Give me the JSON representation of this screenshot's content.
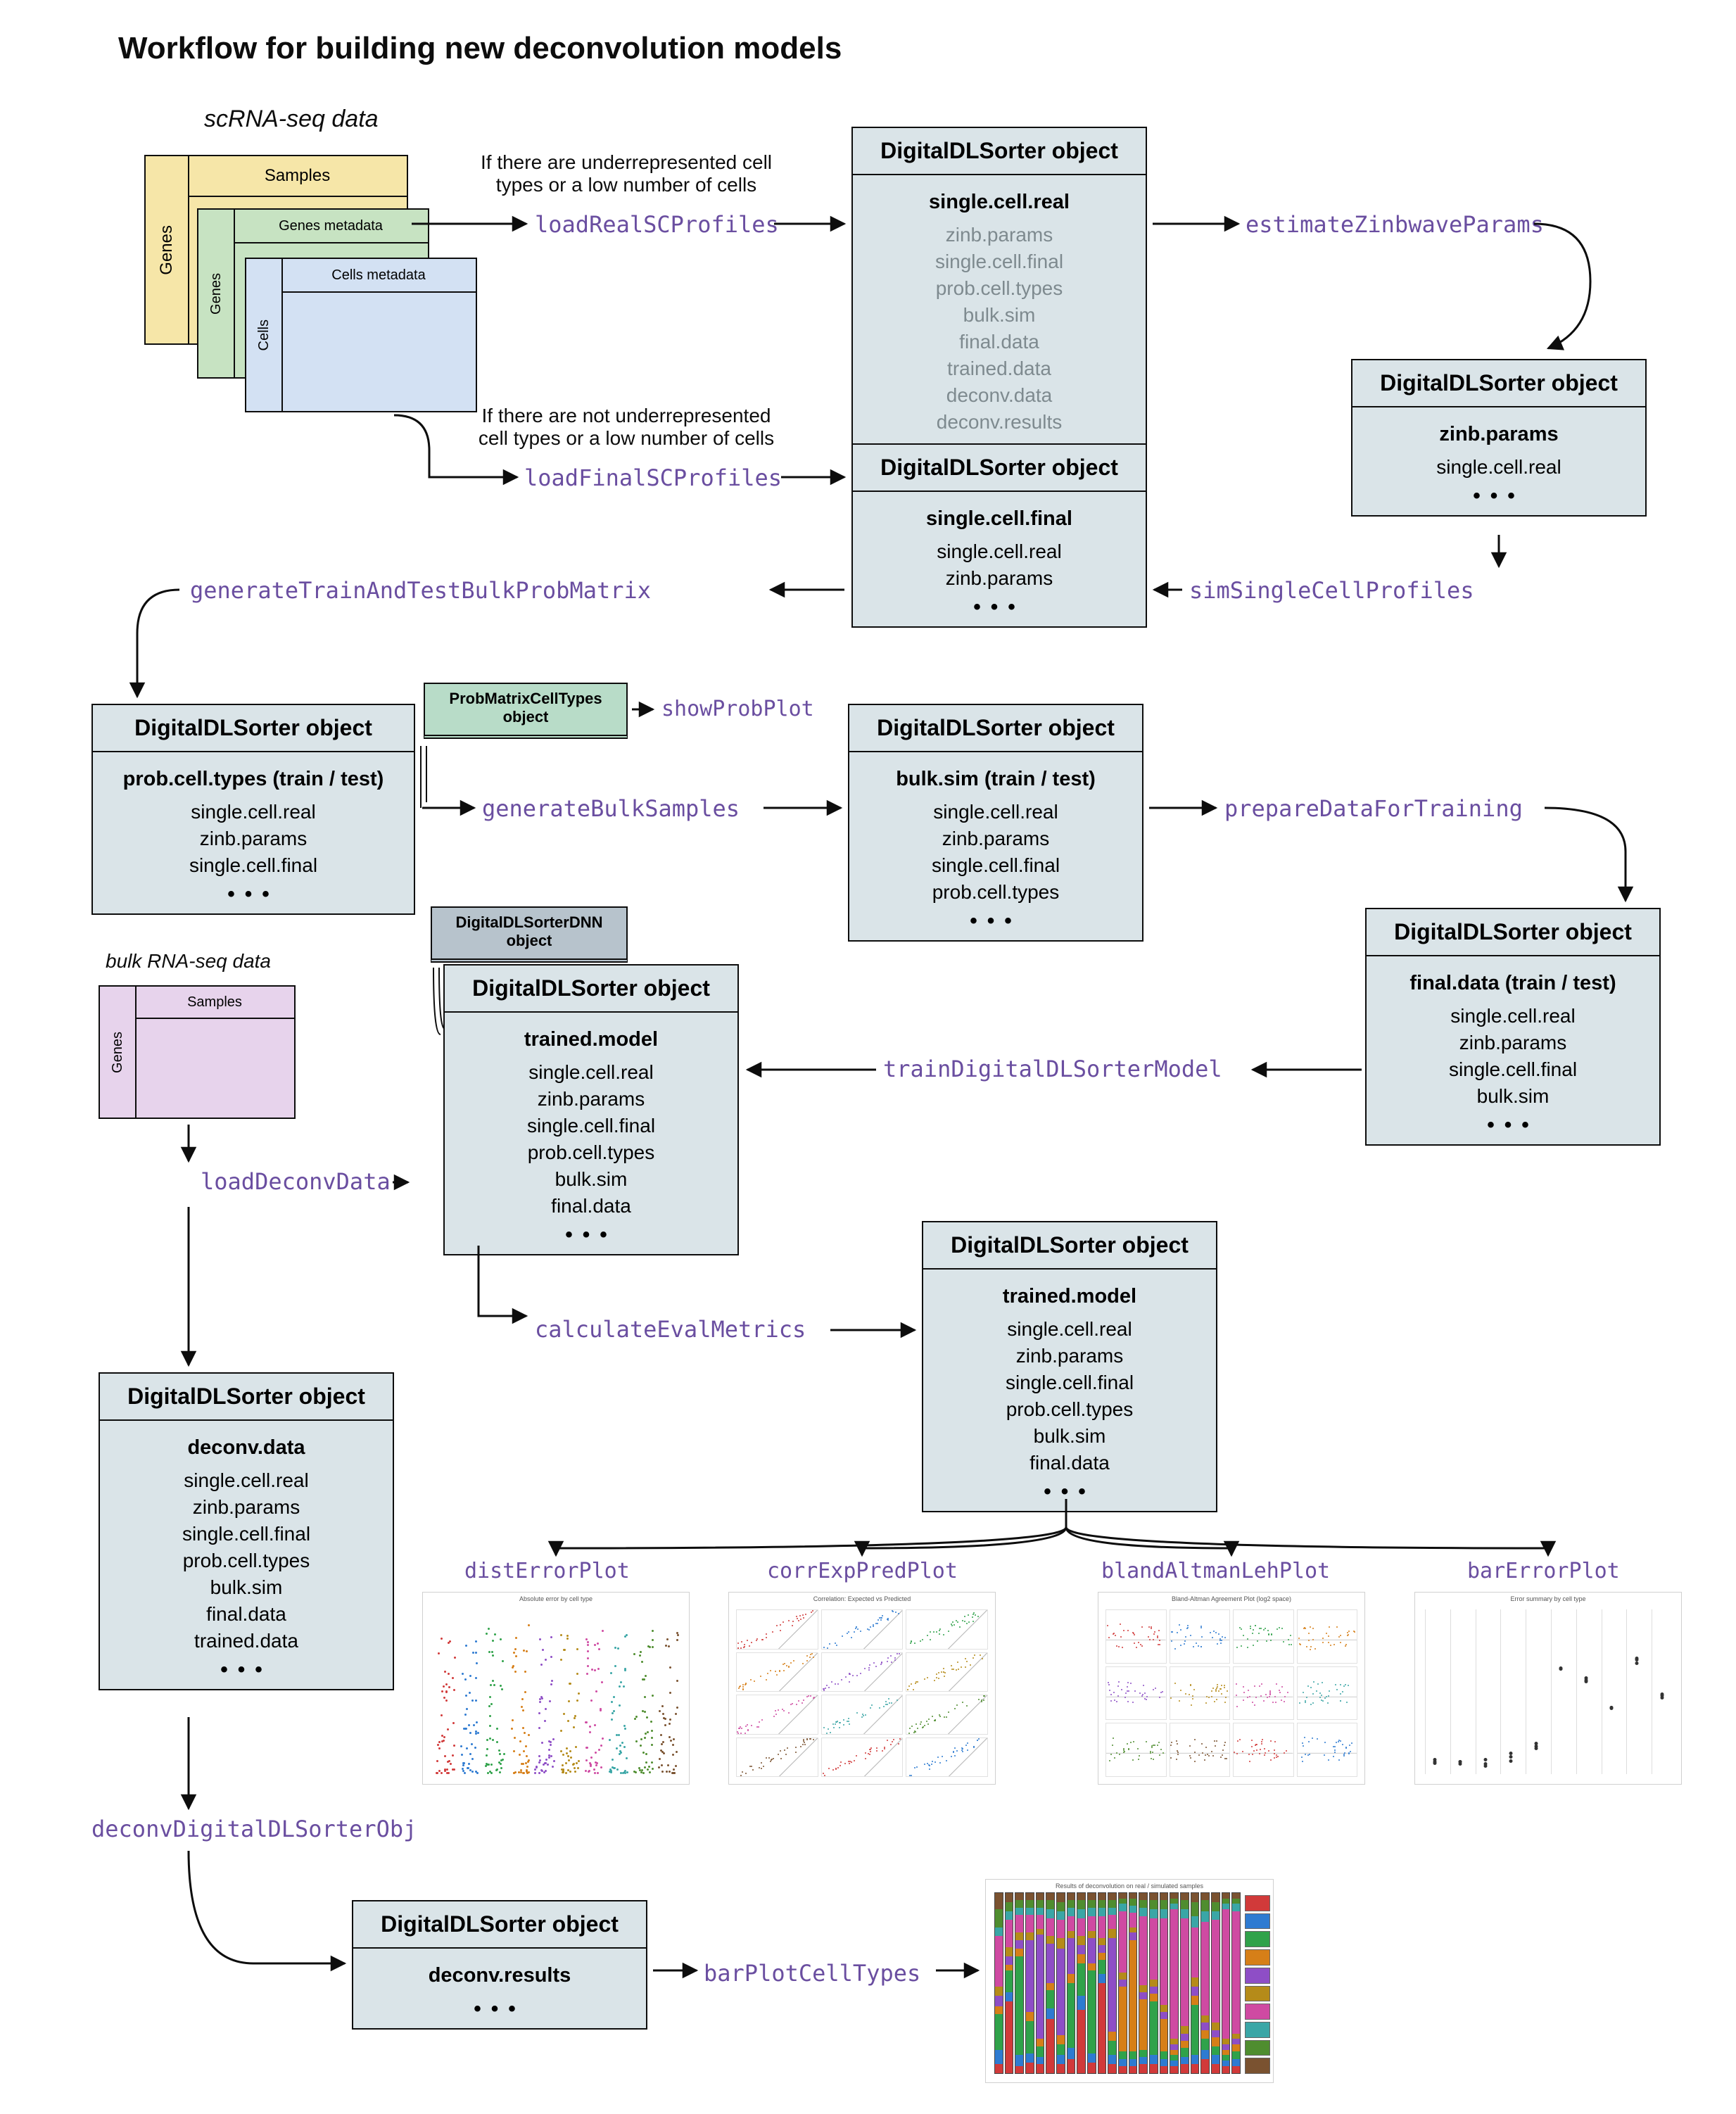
{
  "title": "Workflow for building new deconvolution models",
  "sc_label": "scRNA-seq data",
  "bulk_label": "bulk RNA-seq data",
  "cond1": "If there are underrepresented cell\ntypes or a low number of cells",
  "cond2": "If there are not underrepresented\ncell types or a low number of cells",
  "sc_panels": {
    "samples": {
      "side": "Genes",
      "top": "Samples"
    },
    "gmeta": {
      "side": "Genes",
      "top": "Genes metadata"
    },
    "cmeta": {
      "side": "Cells",
      "top": "Cells metadata"
    }
  },
  "bulk_panel": {
    "side": "Genes",
    "top": "Samples"
  },
  "fn": {
    "loadReal": "loadRealSCProfiles",
    "loadFinal": "loadFinalSCProfiles",
    "estZinb": "estimateZinbwaveParams",
    "simSC": "simSingleCellProfiles",
    "genMat": "generateTrainAndTestBulkProbMatrix",
    "showProb": "showProbPlot",
    "genBulk": "generateBulkSamples",
    "prep": "prepareDataForTraining",
    "train": "trainDigitalDLSorterModel",
    "eval": "calculateEvalMetrics",
    "loadDeconv": "loadDeconvData",
    "deconvObj": "deconvDigitalDLSorterObj",
    "barCT": "barPlotCellTypes",
    "distErr": "distErrorPlot",
    "corr": "corrExpPredPlot",
    "bland": "blandAltmanLehPlot",
    "barErr": "barErrorPlot"
  },
  "mini": {
    "prob": "ProbMatrixCellTypes\nobject",
    "dnn": "DigitalDLSorterDNN\nobject"
  },
  "obj_title": "DigitalDLSorter object",
  "boxes": {
    "scReal": {
      "bold": "single.cell.real",
      "gray": true,
      "slots": [
        "zinb.params",
        "single.cell.final",
        "prob.cell.types",
        "bulk.sim",
        "final.data",
        "trained.data",
        "deconv.data",
        "deconv.results"
      ],
      "dots": false
    },
    "zinb": {
      "bold": "zinb.params",
      "slots": [
        "single.cell.real"
      ],
      "dots": true
    },
    "scFinal": {
      "bold": "single.cell.final",
      "slots": [
        "single.cell.real",
        "zinb.params"
      ],
      "dots": true
    },
    "probCT": {
      "bold": "prob.cell.types (train / test)",
      "slots": [
        "single.cell.real",
        "zinb.params",
        "single.cell.final"
      ],
      "dots": true
    },
    "bulkSim": {
      "bold": "bulk.sim (train / test)",
      "slots": [
        "single.cell.real",
        "zinb.params",
        "single.cell.final",
        "prob.cell.types"
      ],
      "dots": true
    },
    "finalD": {
      "bold": "final.data (train / test)",
      "slots": [
        "single.cell.real",
        "zinb.params",
        "single.cell.final",
        "bulk.sim"
      ],
      "dots": true
    },
    "trained": {
      "bold": "trained.model",
      "slots": [
        "single.cell.real",
        "zinb.params",
        "single.cell.final",
        "prob.cell.types",
        "bulk.sim",
        "final.data"
      ],
      "dots": true
    },
    "evalTrained": {
      "bold": "trained.model",
      "slots": [
        "single.cell.real",
        "zinb.params",
        "single.cell.final",
        "prob.cell.types",
        "bulk.sim",
        "final.data"
      ],
      "dots": true
    },
    "deconvD": {
      "bold": "deconv.data",
      "slots": [
        "single.cell.real",
        "zinb.params",
        "single.cell.final",
        "prob.cell.types",
        "bulk.sim",
        "final.data",
        "trained.data"
      ],
      "dots": true
    },
    "deconvR": {
      "bold": "deconv.results",
      "slots": [],
      "dots": true
    }
  },
  "plot_titles": {
    "jitter": "Absolute error by cell type",
    "corr": "Correlation: Expected vs Predicted",
    "bland": "Bland-Altman Agreement Plot (log2 space)",
    "barerr": "Error summary by cell type",
    "stack": "Results of deconvolution on real / simulated samples"
  },
  "chart_data": {
    "palette": [
      "#d13a3a",
      "#2e7bd1",
      "#30a24a",
      "#d67f18",
      "#8e4ec6",
      "#b58b19",
      "#cf4aa2",
      "#3aa6a6",
      "#4f8d2f",
      "#7a5230"
    ],
    "jitter": {
      "groups": 10,
      "dots_per_group": 45,
      "min": 0,
      "max": 1
    },
    "corr": {
      "panels": 12,
      "dots_per_panel": 35
    },
    "bland": {
      "panels": 12,
      "dots_per_panel": 35
    },
    "barerr": {
      "groups": 10,
      "main": [
        0.06,
        0.05,
        0.04,
        0.07,
        0.12,
        0.48,
        0.42,
        0.3,
        0.52,
        0.36
      ],
      "ylim": [
        0,
        0.7
      ]
    },
    "stack": {
      "samples": 24,
      "segments": 10,
      "proportions": [
        [
          0.05,
          0.08,
          0.2,
          0.04,
          0.06,
          0.05,
          0.28,
          0.05,
          0.1,
          0.09
        ],
        [
          0.4,
          0.05,
          0.12,
          0.03,
          0.05,
          0.05,
          0.15,
          0.05,
          0.05,
          0.05
        ],
        [
          0.04,
          0.06,
          0.55,
          0.04,
          0.05,
          0.04,
          0.1,
          0.04,
          0.04,
          0.04
        ],
        [
          0.06,
          0.05,
          0.18,
          0.05,
          0.4,
          0.04,
          0.1,
          0.04,
          0.04,
          0.04
        ],
        [
          0.05,
          0.04,
          0.06,
          0.04,
          0.58,
          0.03,
          0.08,
          0.04,
          0.04,
          0.04
        ],
        [
          0.3,
          0.06,
          0.1,
          0.04,
          0.22,
          0.04,
          0.1,
          0.05,
          0.05,
          0.04
        ],
        [
          0.05,
          0.05,
          0.06,
          0.05,
          0.48,
          0.06,
          0.1,
          0.05,
          0.05,
          0.05
        ],
        [
          0.08,
          0.06,
          0.36,
          0.05,
          0.2,
          0.04,
          0.08,
          0.05,
          0.04,
          0.04
        ],
        [
          0.35,
          0.08,
          0.18,
          0.05,
          0.05,
          0.05,
          0.1,
          0.05,
          0.05,
          0.04
        ],
        [
          0.06,
          0.05,
          0.46,
          0.04,
          0.14,
          0.04,
          0.08,
          0.05,
          0.04,
          0.04
        ],
        [
          0.5,
          0.05,
          0.08,
          0.04,
          0.04,
          0.04,
          0.12,
          0.05,
          0.04,
          0.04
        ],
        [
          0.05,
          0.05,
          0.08,
          0.05,
          0.52,
          0.05,
          0.08,
          0.04,
          0.04,
          0.04
        ],
        [
          0.04,
          0.04,
          0.04,
          0.36,
          0.04,
          0.04,
          0.34,
          0.04,
          0.03,
          0.03
        ],
        [
          0.04,
          0.04,
          0.04,
          0.62,
          0.04,
          0.03,
          0.08,
          0.04,
          0.04,
          0.03
        ],
        [
          0.05,
          0.04,
          0.04,
          0.28,
          0.04,
          0.04,
          0.38,
          0.05,
          0.04,
          0.04
        ],
        [
          0.05,
          0.05,
          0.3,
          0.04,
          0.04,
          0.04,
          0.34,
          0.05,
          0.05,
          0.04
        ],
        [
          0.04,
          0.04,
          0.04,
          0.18,
          0.04,
          0.04,
          0.48,
          0.05,
          0.05,
          0.04
        ],
        [
          0.04,
          0.03,
          0.03,
          0.03,
          0.03,
          0.03,
          0.72,
          0.03,
          0.03,
          0.03
        ],
        [
          0.05,
          0.04,
          0.05,
          0.04,
          0.04,
          0.04,
          0.6,
          0.05,
          0.05,
          0.04
        ],
        [
          0.05,
          0.05,
          0.28,
          0.05,
          0.05,
          0.05,
          0.28,
          0.06,
          0.08,
          0.05
        ],
        [
          0.08,
          0.05,
          0.06,
          0.05,
          0.04,
          0.04,
          0.52,
          0.06,
          0.06,
          0.04
        ],
        [
          0.05,
          0.05,
          0.05,
          0.05,
          0.04,
          0.04,
          0.57,
          0.05,
          0.05,
          0.05
        ],
        [
          0.04,
          0.03,
          0.03,
          0.03,
          0.03,
          0.03,
          0.72,
          0.03,
          0.03,
          0.03
        ],
        [
          0.04,
          0.04,
          0.04,
          0.04,
          0.03,
          0.03,
          0.68,
          0.04,
          0.03,
          0.03
        ]
      ]
    }
  }
}
